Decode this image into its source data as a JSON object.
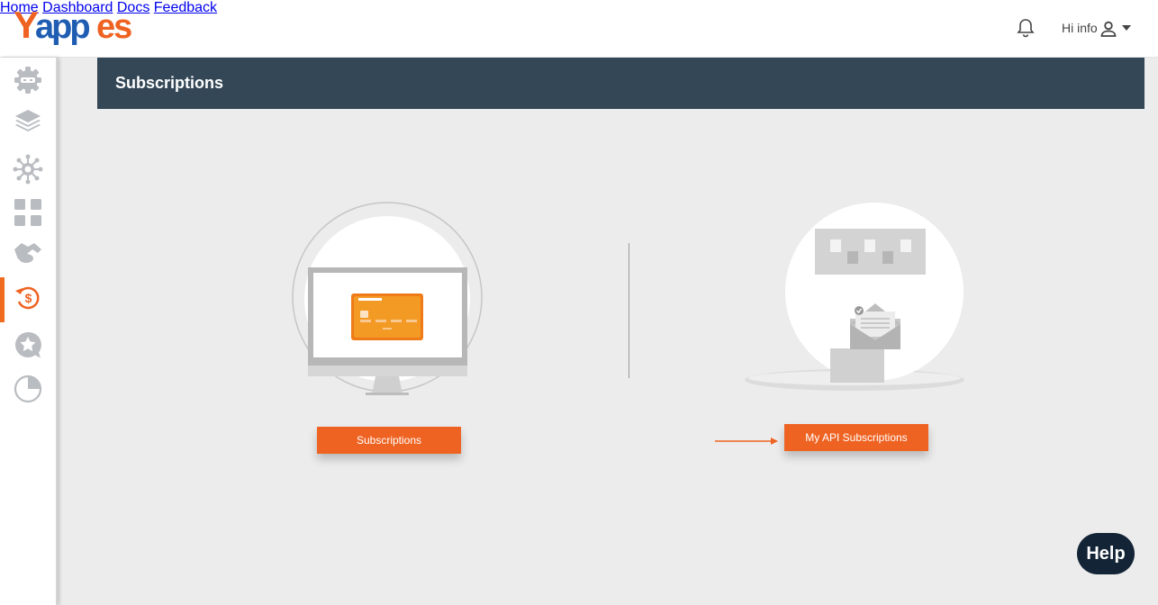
{
  "brand": {
    "logo_text": "Yappes",
    "colors": {
      "primary_orange": "#ef6322",
      "logo_blue": "#1f5db3",
      "header_dark": "#334756",
      "help_dark": "#132436"
    }
  },
  "topnav": {
    "items": [
      {
        "label": "Home"
      },
      {
        "label": "Dashboard"
      },
      {
        "label": "Docs"
      },
      {
        "label": "Feedback"
      }
    ],
    "notifications_icon": "bell-icon",
    "user_greeting": "Hi info",
    "user_icon": "user-icon",
    "dropdown_icon": "caret-down-icon"
  },
  "sidebar": {
    "items": [
      {
        "icon": "api-gear-icon",
        "active": false
      },
      {
        "icon": "layers-icon",
        "active": false
      },
      {
        "icon": "network-hub-icon",
        "active": false
      },
      {
        "icon": "grid-icon",
        "active": false
      },
      {
        "icon": "handshake-icon",
        "active": false
      },
      {
        "icon": "dollar-refresh-icon",
        "active": true
      },
      {
        "icon": "star-review-icon",
        "active": false
      },
      {
        "icon": "pie-chart-icon",
        "active": false
      }
    ]
  },
  "page": {
    "title": "Subscriptions"
  },
  "cards": [
    {
      "illustration": "monitor-credit-card-illustration",
      "button_label": "Subscriptions"
    },
    {
      "illustration": "api-mailbox-illustration",
      "button_label": "My API Subscriptions"
    }
  ],
  "help": {
    "label": "Help"
  }
}
